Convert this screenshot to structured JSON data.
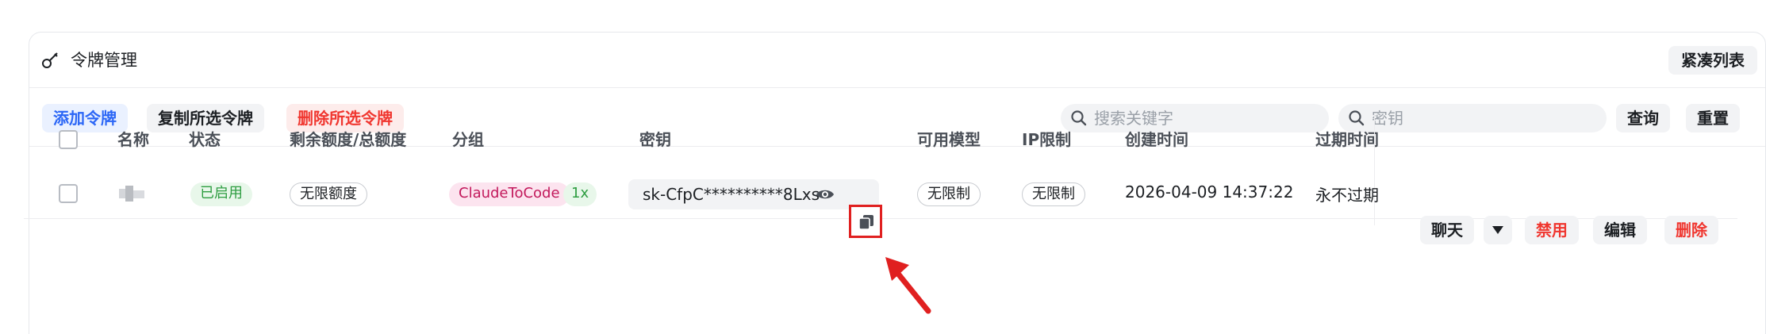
{
  "header": {
    "title": "令牌管理",
    "compact_label": "紧凑列表"
  },
  "toolbar": {
    "add_label": "添加令牌",
    "copy_selected_label": "复制所选令牌",
    "delete_selected_label": "删除所选令牌",
    "search_keyword_placeholder": "搜索关键字",
    "search_key_placeholder": "密钥",
    "query_label": "查询",
    "reset_label": "重置"
  },
  "table": {
    "columns": [
      "名称",
      "状态",
      "剩余额度/总额度",
      "分组",
      "密钥",
      "可用模型",
      "IP限制",
      "创建时间",
      "过期时间"
    ],
    "rows": [
      {
        "status": "已启用",
        "quota": "无限额度",
        "group": "ClaudeToCode",
        "ratio": "1x",
        "key": "sk-CfpC**********8Lxs",
        "models": "无限制",
        "ip_limit": "无限制",
        "created": "2026-04-09 14:37:22",
        "expires": "永不过期",
        "actions": {
          "chat": "聊天",
          "disable": "禁用",
          "edit": "编辑",
          "delete": "删除"
        }
      }
    ]
  },
  "colors": {
    "accent_blue": "#2b66f6",
    "danger_red": "#f0362f",
    "success_green": "#2e9d41",
    "highlight_red": "#e02020"
  },
  "icons": {
    "title": "key-icon",
    "search": "search-icon",
    "reveal": "eye-icon",
    "copy": "copy-icon",
    "dropdown": "caret-down-icon",
    "annotation": "arrow-annotation"
  }
}
